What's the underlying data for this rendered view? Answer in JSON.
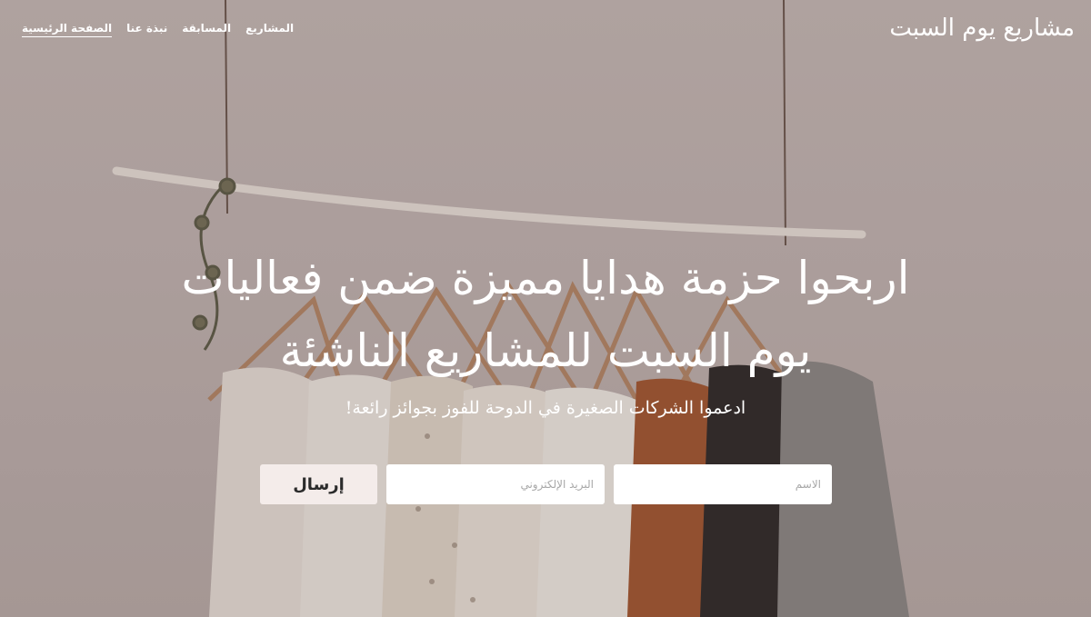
{
  "header": {
    "brand": "مشاريع يوم السبت",
    "nav": [
      {
        "label": "الصفحة الرئيسية",
        "active": true
      },
      {
        "label": "نبذة عنا",
        "active": false
      },
      {
        "label": "المسابقة",
        "active": false
      },
      {
        "label": "المشاريع",
        "active": false
      }
    ]
  },
  "hero": {
    "title_line1": "اربحوا حزمة هدايا مميزة  ضمن فعاليات",
    "title_line2": "يوم السبت للمشاريع الناشئة",
    "subtitle": "ادعموا الشركات الصغيرة في الدوحة للفوز بجوائز رائعة!",
    "background_image": "clothes hanging on a rack against a wall"
  },
  "form": {
    "name_placeholder": "الاسم",
    "email_placeholder": "البريد الإلكتروني",
    "submit_label": "إرسال"
  },
  "colors": {
    "background": "#c4b8b5",
    "button_bg": "#f4ecea",
    "text": "#ffffff"
  }
}
